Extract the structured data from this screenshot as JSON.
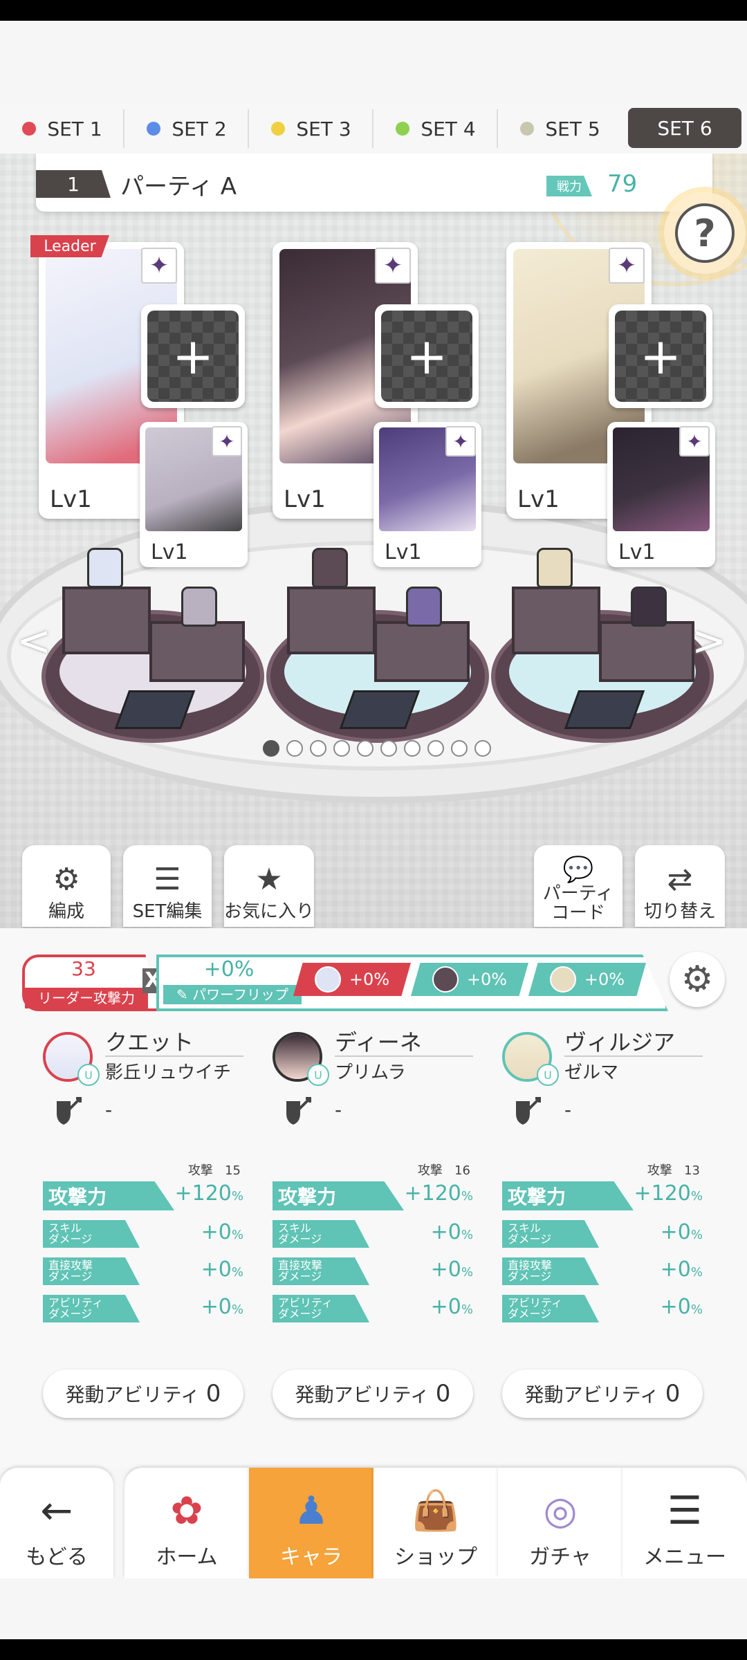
{
  "set_tabs": [
    {
      "label": "SET 1",
      "dot": "#e04a56"
    },
    {
      "label": "SET 2",
      "dot": "#5b8de8"
    },
    {
      "label": "SET 3",
      "dot": "#f0d040"
    },
    {
      "label": "SET 4",
      "dot": "#8ed050"
    },
    {
      "label": "SET 5",
      "dot": "#c8c8b0"
    },
    {
      "label": "SET 6",
      "dot": ""
    }
  ],
  "party": {
    "number": "1",
    "name": "パーティ A",
    "power_label": "戦力",
    "power_value": "79"
  },
  "help_label": "?",
  "leader_badge": "Leader",
  "cards": [
    {
      "main_level": "Lv1",
      "sub_level": "Lv1",
      "main_color": "#dfe4f4",
      "sub_color": "#b9b0c0"
    },
    {
      "main_level": "Lv1",
      "sub_level": "Lv1",
      "main_color": "#5c4a55",
      "sub_color": "#7b6aa8"
    },
    {
      "main_level": "Lv1",
      "sub_level": "Lv1",
      "main_color": "#e8dcc0",
      "sub_color": "#3d3340"
    }
  ],
  "carousel": {
    "count": 10,
    "active": 0
  },
  "actions": {
    "formation": "編成",
    "set_edit": "SET編集",
    "favorites": "お気に入り",
    "party_code": "パーティ\nコード",
    "switch": "切り替え"
  },
  "summary": {
    "leader_attack_value": "33",
    "leader_attack_label": "リーダー攻撃力",
    "x": "X",
    "power_flip_value": "+0%",
    "power_flip_label": "パワーフリップ",
    "chips": [
      "+0%",
      "+0%",
      "+0%"
    ]
  },
  "columns": [
    {
      "name": "クエット",
      "sub": "影丘リュウイチ",
      "weapon": "-",
      "atk_label": "攻撃",
      "atk_num": "15",
      "attack": {
        "label": "攻撃力",
        "value": "+120",
        "unit": "%"
      },
      "skill": {
        "label": "スキル\nダメージ",
        "value": "+0",
        "unit": "%"
      },
      "direct": {
        "label": "直接攻撃\nダメージ",
        "value": "+0",
        "unit": "%"
      },
      "ability": {
        "label": "アビリティ\nダメージ",
        "value": "+0",
        "unit": "%"
      },
      "ability_button_label": "発動アビリティ",
      "ability_button_count": "0"
    },
    {
      "name": "ディーネ",
      "sub": "プリムラ",
      "weapon": "-",
      "atk_label": "攻撃",
      "atk_num": "16",
      "attack": {
        "label": "攻撃力",
        "value": "+120",
        "unit": "%"
      },
      "skill": {
        "label": "スキル\nダメージ",
        "value": "+0",
        "unit": "%"
      },
      "direct": {
        "label": "直接攻撃\nダメージ",
        "value": "+0",
        "unit": "%"
      },
      "ability": {
        "label": "アビリティ\nダメージ",
        "value": "+0",
        "unit": "%"
      },
      "ability_button_label": "発動アビリティ",
      "ability_button_count": "0"
    },
    {
      "name": "ヴィルジア",
      "sub": "ゼルマ",
      "weapon": "-",
      "atk_label": "攻撃",
      "atk_num": "13",
      "attack": {
        "label": "攻撃力",
        "value": "+120",
        "unit": "%"
      },
      "skill": {
        "label": "スキル\nダメージ",
        "value": "+0",
        "unit": "%"
      },
      "direct": {
        "label": "直接攻撃\nダメージ",
        "value": "+0",
        "unit": "%"
      },
      "ability": {
        "label": "アビリティ\nダメージ",
        "value": "+0",
        "unit": "%"
      },
      "ability_button_label": "発動アビリティ",
      "ability_button_count": "0"
    }
  ],
  "nav": {
    "back": "もどる",
    "home": "ホーム",
    "chara": "キャラ",
    "shop": "ショップ",
    "gacha": "ガチャ",
    "menu": "メニュー"
  },
  "colors": {
    "accent": "#5fc3b5",
    "leader_red": "#d9424d",
    "active_nav": "#f5a33a",
    "dark_tab": "#4d4845"
  }
}
